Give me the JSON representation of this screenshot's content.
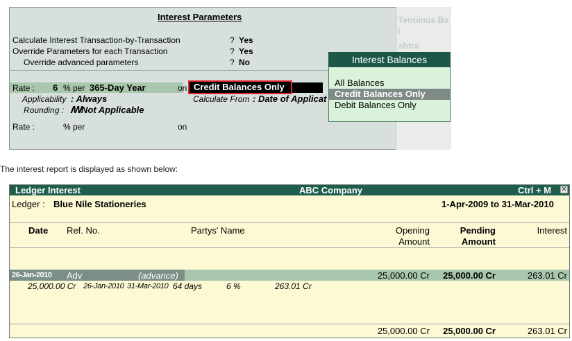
{
  "interest_parameters": {
    "title": "Interest Parameters",
    "lines": [
      {
        "label": "Calculate Interest Transaction-by-Transaction",
        "q": "?",
        "value": "Yes"
      },
      {
        "label": "Override Parameters for each Transaction",
        "q": "?",
        "value": "Yes"
      },
      {
        "label": "Override advanced parameters",
        "q": "?",
        "value": "No"
      }
    ],
    "rate_label": "Rate :",
    "rate_value": "6",
    "rate_per": "% per",
    "rate_period": "365-Day Year",
    "on_label": "on",
    "on_value": "Credit Balances Only",
    "applicability_label": "Applicability",
    "applicability_value": ": Always",
    "rounding_label": "Rounding :",
    "rounding_value": "Not Applicable",
    "rounding_glyph": "ꟿ",
    "calc_from_label": "Calculate From",
    "calc_from_value": ": Date of Applicat",
    "rate2_label": "Rate :",
    "rate2_per": "% per",
    "rate2_on": "on"
  },
  "background_text": {
    "terminus": "Terminus Bo",
    "bar": "l",
    "shtra": "shtra"
  },
  "popup": {
    "title": "Interest Balances",
    "items": [
      "All Balances",
      "Credit Balances Only",
      "Debit Balances Only"
    ],
    "selected_index": 1
  },
  "caption": "The interest report is displayed as shown below:",
  "report": {
    "title": "Ledger Interest",
    "company": "ABC Company",
    "shortcut": "Ctrl + M",
    "close": "✕",
    "ledger_label": "Ledger :",
    "ledger_name": "Blue Nile Stationeries",
    "period": "1-Apr-2009 to 31-Mar-2010",
    "columns": {
      "date": "Date",
      "ref_no": "Ref. No.",
      "party": "Partys' Name",
      "opening_1": "Opening",
      "opening_2": "Amount",
      "pending_1": "Pending",
      "pending_2": "Amount",
      "interest": "Interest"
    },
    "row": {
      "date": "26-Jan-2010",
      "ref": "Adv",
      "type": "(advance)",
      "opening": "25,000.00 Cr",
      "pending": "25,000.00 Cr",
      "interest": "263.01 Cr"
    },
    "detail": {
      "amount": "25,000.00 Cr",
      "from": "26-Jan-2010",
      "to": "31-Mar-2010",
      "days": "64 days",
      "rate": "6 %",
      "interest": "263.01 Cr"
    },
    "totals": {
      "opening": "25,000.00 Cr",
      "pending": "25,000.00 Cr",
      "interest": "263.01 Cr"
    }
  }
}
